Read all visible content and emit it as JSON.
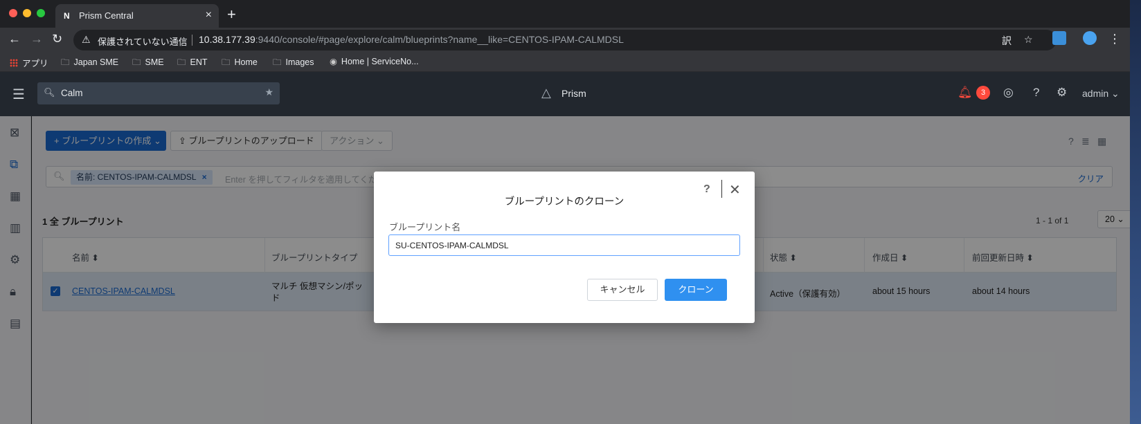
{
  "browser": {
    "tab_title": "Prism Central",
    "tab_favicon": "N",
    "security_label": "保護されていない通信",
    "url_host": "10.38.177.39",
    "url_rest": ":9440/console/#page/explore/calm/blueprints?name__like=CENTOS-IPAM-CALMDSL",
    "bookmarks": [
      "アプリ",
      "Japan SME",
      "SME",
      "ENT",
      "Home",
      "Images",
      "Home | ServiceNo..."
    ]
  },
  "app_header": {
    "search_value": "Calm",
    "title": "Prism",
    "alert_count": "3",
    "user": "admin"
  },
  "toolbar": {
    "create_label": "+ ブループリントの作成",
    "upload_label": "ブループリントのアップロード",
    "actions_label": "アクション"
  },
  "filter": {
    "chip_label": "名前: CENTOS-IPAM-CALMDSL",
    "placeholder": "Enter を押してフィルタを適用してください",
    "clear_label": "クリア"
  },
  "list": {
    "count_label": "1 全 ブループリント",
    "paging": "1 - 1 of 1",
    "per_page": "20"
  },
  "table": {
    "headers": [
      "名前 ⬍",
      "ブループリントタイプ",
      "状態 ⬍",
      "作成日 ⬍",
      "前回更新日時 ⬍"
    ],
    "rows": [
      {
        "name": "CENTOS-IPAM-CALMDSL",
        "type_line1": "マルチ 仮想マシン/ポッ",
        "type_line2": "ド",
        "state": "Active（保護有効）",
        "created": "about 15 hours",
        "updated": "about 14 hours"
      }
    ]
  },
  "modal": {
    "title": "ブループリントのクローン",
    "help": "?",
    "field_label": "ブループリント名",
    "field_value": "SU-CENTOS-IPAM-CALMDSL",
    "cancel_label": "キャンセル",
    "clone_label": "クローン"
  },
  "colors": {
    "accent": "#1b6bd1",
    "clone_button": "#2f90f0",
    "alert": "#ff4a3d"
  }
}
